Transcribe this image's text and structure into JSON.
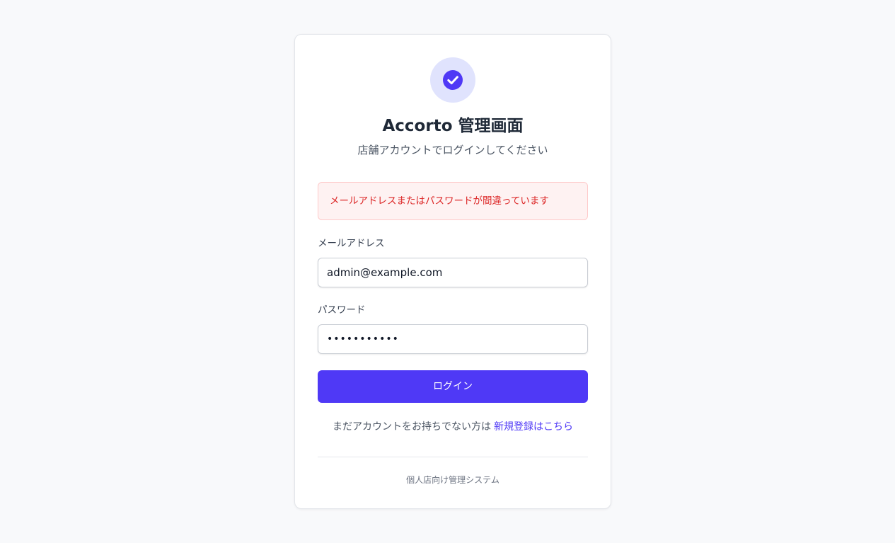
{
  "header": {
    "logo_icon": "check-circle-icon",
    "title": "Accorto 管理画面",
    "subtitle": "店舗アカウントでログインしてください"
  },
  "error": {
    "message": "メールアドレスまたはパスワードが間違っています"
  },
  "form": {
    "email_label": "メールアドレス",
    "email_value": "admin@example.com",
    "password_label": "パスワード",
    "password_value": "•••••••••••",
    "submit_label": "ログイン"
  },
  "signup": {
    "prompt": "まだアカウントをお持ちでない方は",
    "link": "新規登録はこちら"
  },
  "footer": {
    "text": "個人店向け管理システム"
  },
  "colors": {
    "accent": "#4f39f6",
    "background": "#f8f9fb",
    "error_text": "#dc2626",
    "error_bg": "#fef2f2"
  }
}
